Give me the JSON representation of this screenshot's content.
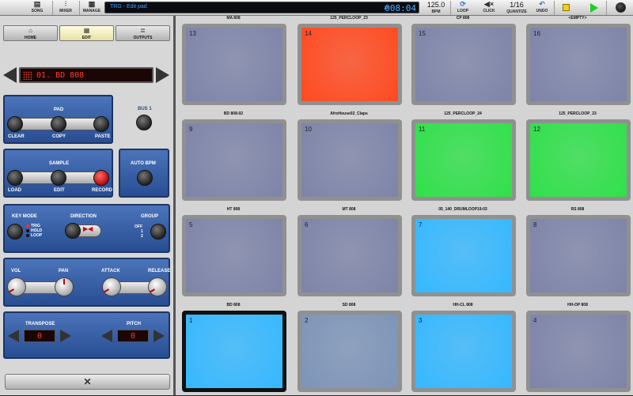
{
  "toolbar": {
    "song": "SONG",
    "mixer": "MIXER",
    "manage": "MANAGE",
    "lcd_title": "TRG - Edit pad",
    "time": "008:04",
    "bpm_value": "125.0",
    "bpm_label": "BPM",
    "loop_label": "LOOP",
    "click_label": "CLICK",
    "quantize_value": "1/16",
    "quantize_label": "QUANTIZE",
    "undo_label": "UNDO",
    "stop_color": "#f0d020",
    "play_color": "#1fcf1f"
  },
  "tabs": {
    "home": "HOME",
    "edit": "EDIT",
    "outputs": "OUTPUTS"
  },
  "pad_select": {
    "value": "01. BD 808"
  },
  "pad_box": {
    "title": "PAD",
    "clear": "CLEAR",
    "copy": "COPY",
    "paste": "PASTE"
  },
  "bus": {
    "label": "BUS 1"
  },
  "sample_box": {
    "title": "SAMPLE",
    "load": "LOAD",
    "edit": "EDIT",
    "record": "RECORD"
  },
  "auto_bpm": {
    "label": "AUTO BPM"
  },
  "keymode": {
    "label": "KEY MODE",
    "options": [
      "TRIG",
      "HOLD",
      "LOOP"
    ],
    "selected": "TRIG"
  },
  "direction": {
    "label": "DIRECTION"
  },
  "group": {
    "label": "GROUP",
    "options": [
      "OFF",
      "1",
      "2"
    ]
  },
  "levels": {
    "vol": "VOL",
    "pan": "PAN",
    "attack": "ATTACK",
    "release": "RELEASE"
  },
  "transpose": {
    "label": "TRANSPOSE",
    "value": "0"
  },
  "pitch": {
    "label": "PITCH",
    "value": "0"
  },
  "pads": [
    {
      "num": "13",
      "name": "MA 808",
      "color": "#7d84a8"
    },
    {
      "num": "14",
      "name": "125_PERCLOOP_23",
      "color": "#ff4a20"
    },
    {
      "num": "15",
      "name": "CP 808",
      "color": "#7d84a8"
    },
    {
      "num": "16",
      "name": "<EMPTY>",
      "color": "#7d84a8"
    },
    {
      "num": "9",
      "name": "BD 808-02",
      "color": "#7d84a8"
    },
    {
      "num": "10",
      "name": "AfroHouse02_Claps",
      "color": "#7d84a8"
    },
    {
      "num": "11",
      "name": "125_PERCLOOP_24",
      "color": "#30e04a"
    },
    {
      "num": "12",
      "name": "125_PERCLOOP_23",
      "color": "#30e04a"
    },
    {
      "num": "5",
      "name": "HT 808",
      "color": "#7d84a8"
    },
    {
      "num": "6",
      "name": "MT 808",
      "color": "#7d84a8"
    },
    {
      "num": "7",
      "name": "05_140_DRUMLOOP19-03",
      "color": "#35b8ff"
    },
    {
      "num": "8",
      "name": "RS 808",
      "color": "#7d84a8"
    },
    {
      "num": "1",
      "name": "BD 808",
      "color": "#35b8ff"
    },
    {
      "num": "2",
      "name": "SD 808",
      "color": "#7d94b8"
    },
    {
      "num": "3",
      "name": "HH-CL 808",
      "color": "#35b8ff"
    },
    {
      "num": "4",
      "name": "HH-OP 808",
      "color": "#7d84a8"
    }
  ]
}
